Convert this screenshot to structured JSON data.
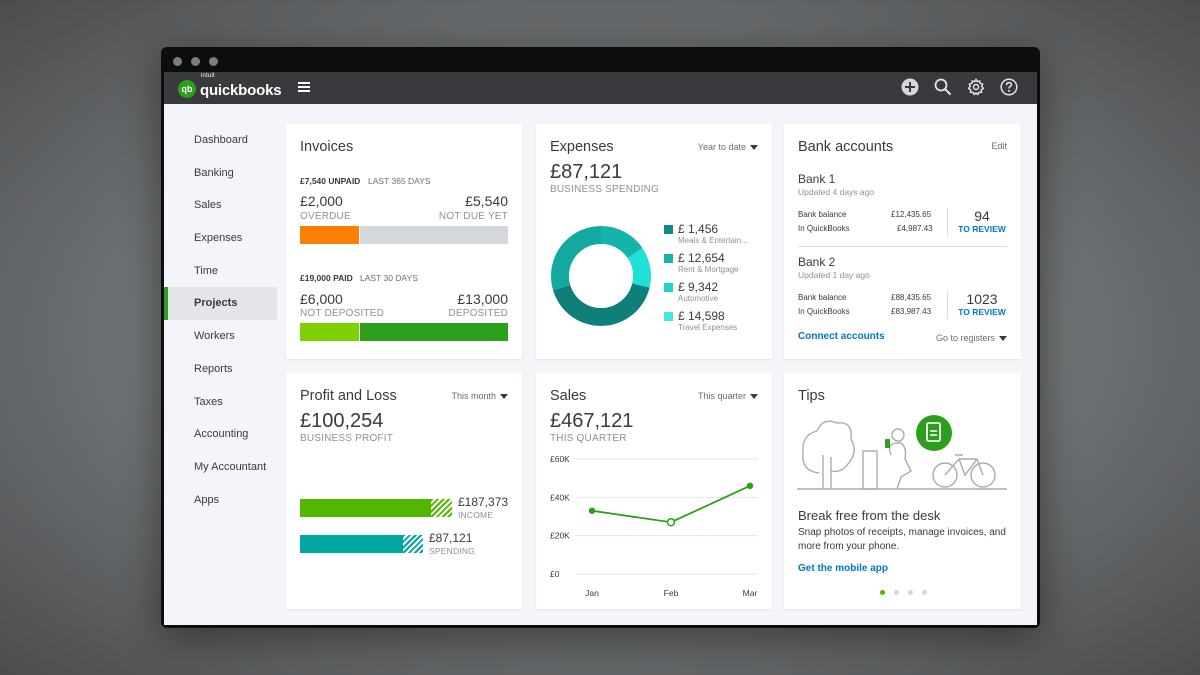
{
  "app": {
    "brand_small": "intuit",
    "brand": "quickbooks",
    "logo_mark": "qb"
  },
  "sidebar": {
    "items": [
      {
        "label": "Dashboard"
      },
      {
        "label": "Banking"
      },
      {
        "label": "Sales"
      },
      {
        "label": "Expenses"
      },
      {
        "label": "Time"
      },
      {
        "label": "Projects",
        "active": true
      },
      {
        "label": "Workers"
      },
      {
        "label": "Reports"
      },
      {
        "label": "Taxes"
      },
      {
        "label": "Accounting"
      },
      {
        "label": "My Accountant"
      },
      {
        "label": "Apps"
      }
    ]
  },
  "invoices": {
    "title": "Invoices",
    "unpaid_amount": "£7,540 UNPAID",
    "unpaid_period": "LAST 365 DAYS",
    "overdue_value": "£2,000",
    "overdue_label": "OVERDUE",
    "not_due_value": "£5,540",
    "not_due_label": "NOT DUE YET",
    "paid_amount": "£19,000 PAID",
    "paid_period": "LAST 30 DAYS",
    "not_deposited_value": "£6,000",
    "not_deposited_label": "NOT DEPOSITED",
    "deposited_value": "£13,000",
    "deposited_label": "DEPOSITED",
    "colors": {
      "overdue": "#ff8000",
      "not_due": "#d4d7dc",
      "not_deposited": "#7fd000",
      "deposited": "#2ca01c"
    }
  },
  "expenses": {
    "title": "Expenses",
    "period": "Year to date",
    "total": "£87,121",
    "total_label": "BUSINESS SPENDING",
    "categories": [
      {
        "value": "£ 1,456",
        "label": "Meals & Entertain...",
        "color": "#108c86"
      },
      {
        "value": "£ 12,654",
        "label": "Rent & Mortgage",
        "color": "#14b3ab"
      },
      {
        "value": "£ 9,342",
        "label": "Automotive",
        "color": "#21d3c8"
      },
      {
        "value": "£ 14,598",
        "label": "Travel Expenses",
        "color": "#3ee9df"
      }
    ]
  },
  "bank": {
    "title": "Bank accounts",
    "edit": "Edit",
    "accounts": [
      {
        "name": "Bank 1",
        "updated": "Updated 4 days ago",
        "bank_balance_label": "Bank balance",
        "bank_balance": "£12,435.65",
        "qb_label": "In QuickBooks",
        "qb_balance": "£4,987.43",
        "review_count": "94",
        "review_label": "TO REVIEW"
      },
      {
        "name": "Bank 2",
        "updated": "Updated 1 day ago",
        "bank_balance_label": "Bank balance",
        "bank_balance": "£88,435.65",
        "qb_label": "In QuickBooks",
        "qb_balance": "£83,987.43",
        "review_count": "1023",
        "review_label": "TO REVIEW"
      }
    ],
    "connect": "Connect accounts",
    "go_to": "Go to registers"
  },
  "pnl": {
    "title": "Profit and Loss",
    "period": "This month",
    "total": "£100,254",
    "total_label": "BUSINESS PROFIT",
    "income_value": "£187,373",
    "income_label": "INCOME",
    "spending_value": "£87,121",
    "spending_label": "SPENDING",
    "colors": {
      "income": "#53b700",
      "spending": "#00a6a4"
    }
  },
  "sales": {
    "title": "Sales",
    "period": "This quarter",
    "total": "£467,121",
    "total_label": "THIS QUARTER"
  },
  "chart_data": {
    "type": "line",
    "x": [
      "Jan",
      "Feb",
      "Mar"
    ],
    "series": [
      {
        "values": [
          33000,
          27000,
          46000
        ]
      }
    ],
    "yticks": [
      "£60K",
      "£40K",
      "£20K",
      "£0"
    ],
    "ylim": [
      0,
      60000
    ],
    "grid": true,
    "color": "#2ca01c"
  },
  "tips": {
    "title": "Tips",
    "heading": "Break free from the desk",
    "body": "Snap photos of receipts, manage invoices, and more from your phone.",
    "link": "Get the mobile app"
  }
}
